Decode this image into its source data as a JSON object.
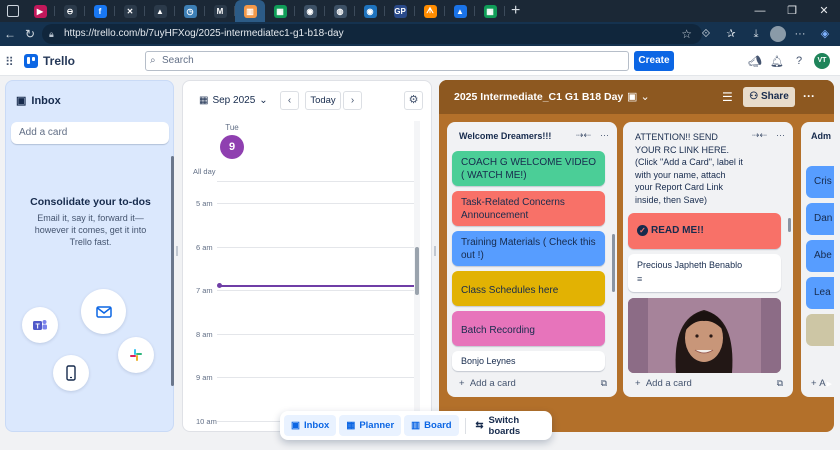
{
  "browser": {
    "tabs": [
      {
        "color": "#c2185b",
        "glyph": "▶"
      },
      {
        "color": "#2b3a4a",
        "glyph": "⊖"
      },
      {
        "color": "#1877f2",
        "glyph": "f"
      },
      {
        "color": "#2b3a4a",
        "glyph": "✕"
      },
      {
        "color": "#2b3a4a",
        "glyph": "▲"
      },
      {
        "color": "#3d7fb5",
        "glyph": "◷"
      },
      {
        "color": "#2b3a4a",
        "glyph": "M"
      },
      {
        "color": "#f2994a",
        "glyph": "▥",
        "active": true
      },
      {
        "color": "#0f9d58",
        "glyph": "▦"
      },
      {
        "color": "#3d5166",
        "glyph": "◉"
      },
      {
        "color": "#3d5166",
        "glyph": "◍"
      },
      {
        "color": "#1e73be",
        "glyph": "◉"
      },
      {
        "color": "#2a4a8a",
        "glyph": "GP"
      },
      {
        "color": "#ff8c00",
        "glyph": "ᗑ"
      },
      {
        "color": "#1a73e8",
        "glyph": "▲"
      },
      {
        "color": "#0f9d58",
        "glyph": "▦"
      }
    ],
    "url": "https://trello.com/b/7uyHFXog/2025-intermediatec1-g1-b18-day"
  },
  "header": {
    "logo_text": "Trello",
    "search_placeholder": "Search",
    "create_label": "Create",
    "user_initials": "VT"
  },
  "inbox": {
    "title": "Inbox",
    "add_card_label": "Add a card",
    "empty_title": "Consolidate your to-dos",
    "empty_body": "Email it, say it, forward it—however it comes, get it into Trello fast."
  },
  "planner": {
    "month": "Sep 2025",
    "today_label": "Today",
    "day_name": "Tue",
    "day_number": "9",
    "all_day_label": "All day",
    "hours": [
      "5 am",
      "6 am",
      "7 am",
      "8 am",
      "9 am",
      "10 am"
    ]
  },
  "board": {
    "title": "2025 Intermediate_C1 G1 B18 Day",
    "share_label": "Share",
    "lists": [
      {
        "title": "Welcome Dreamers!!!",
        "cards": [
          {
            "text": "COACH G WELCOME VIDEO ( WATCH ME!)",
            "color": "#4bce97"
          },
          {
            "text": "Task-Related Concerns Announcement",
            "color": "#f87168"
          },
          {
            "text": "Training Materials ( Check this out !)",
            "color": "#579dff"
          },
          {
            "text": "Class Schedules here",
            "color": "#e2b203"
          },
          {
            "text": "Batch Recording",
            "color": "#e774bb"
          },
          {
            "text": "Bonjo Leynes",
            "color": "#ffffff"
          }
        ],
        "add_label": "Add a card"
      },
      {
        "title": "ATTENTION!! SEND YOUR RC LINK HERE. (Click \"Add a Card\", label it with your name, attach your Report Card Link inside, then Save)",
        "cards": [
          {
            "text": "READ ME!!",
            "color": "#f87168"
          },
          {
            "text": "Precious Japheth Benablo",
            "color": "#ffffff"
          }
        ],
        "add_label": "Add a card"
      },
      {
        "title": "Adm",
        "cards": [
          {
            "text": "Cris"
          },
          {
            "text": "Dan"
          },
          {
            "text": "Abe"
          },
          {
            "text": "Lea"
          }
        ],
        "add_label": "A"
      }
    ]
  },
  "switcher": {
    "inbox": "Inbox",
    "planner": "Planner",
    "board": "Board",
    "switch": "Switch boards"
  }
}
